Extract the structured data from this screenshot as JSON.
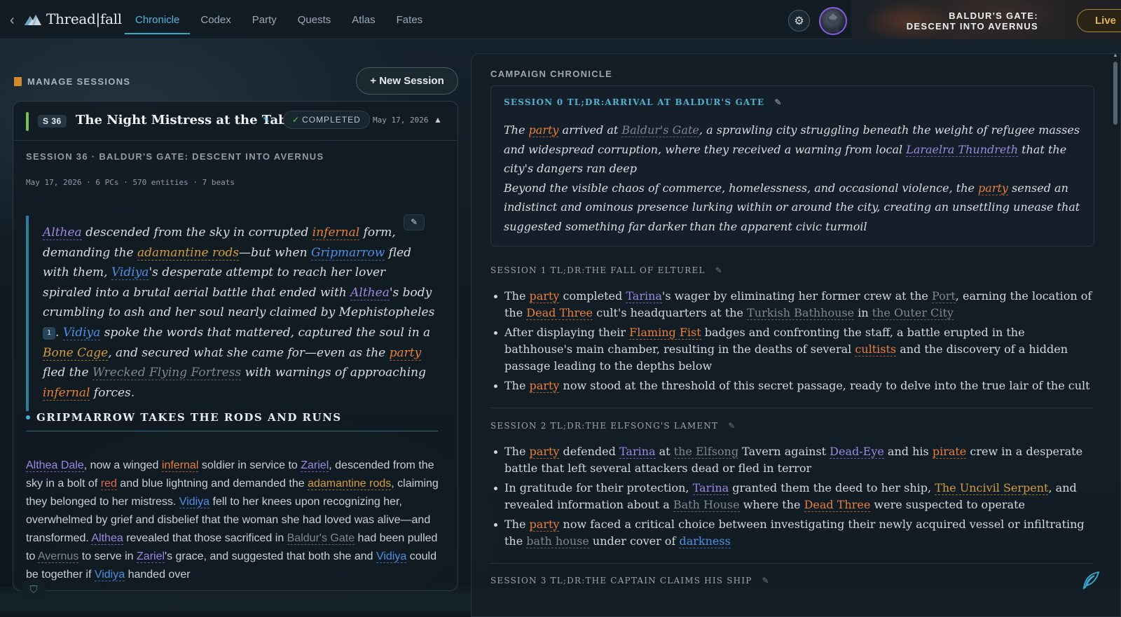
{
  "nav": {
    "back_glyph": "‹",
    "logo_text": "Thread|fall",
    "tabs": [
      {
        "label": "Chronicle",
        "active": true
      },
      {
        "label": "Codex"
      },
      {
        "label": "Party"
      },
      {
        "label": "Quests"
      },
      {
        "label": "Atlas"
      },
      {
        "label": "Fates"
      }
    ],
    "settings_icon": "gear-icon",
    "campaign_title_line1": "BALDUR'S GATE:",
    "campaign_title_line2": "DESCENT INTO AVERNUS",
    "live_label": "Live"
  },
  "sessions": {
    "manage_label": "MANAGE SESSIONS",
    "new_session_label": "+ New Session",
    "card": {
      "badge": "S 36",
      "title": "The Night Mistress at the Table",
      "status": "COMPLETED",
      "date": "May 17, 2026",
      "subtitle": "SESSION 36 · BALDUR'S GATE: DESCENT INTO AVERNUS",
      "meta": "May 17, 2026 · 6 PCs · 570 entities · 7 beats",
      "citation": "1",
      "beat_heading": "GRIPMARROW TAKES THE RODS AND RUNS",
      "summary_segments": [
        {
          "t": "Althea",
          "c": "e-purple"
        },
        {
          "t": " descended from the sky in corrupted "
        },
        {
          "t": "infernal",
          "c": "e-orange"
        },
        {
          "t": " form, demanding the "
        },
        {
          "t": "adamantine rods",
          "c": "e-gold"
        },
        {
          "t": "—but when "
        },
        {
          "t": "Gripmarrow",
          "c": "e-blue"
        },
        {
          "t": " fled with them, "
        },
        {
          "t": "Vidiya",
          "c": "e-blue"
        },
        {
          "t": "'s desperate attempt to reach her lover spiraled into a brutal aerial battle that ended with "
        },
        {
          "t": "Althea",
          "c": "e-purple"
        },
        {
          "t": "'s body crumbling to ash and her soul nearly claimed by Mephistopheles "
        },
        {
          "t": "1",
          "c": "cite"
        },
        {
          "t": ". "
        },
        {
          "t": "Vidiya",
          "c": "e-blue"
        },
        {
          "t": " spoke the words that mattered, captured the soul in a "
        },
        {
          "t": "Bone Cage",
          "c": "e-gold"
        },
        {
          "t": ", and secured what she came for—even as the "
        },
        {
          "t": "party",
          "c": "e-orange"
        },
        {
          "t": " fled the "
        },
        {
          "t": "Wrecked Flying Fortress",
          "c": "e-grey"
        },
        {
          "t": " with warnings of approaching "
        },
        {
          "t": "infernal",
          "c": "e-orange"
        },
        {
          "t": " forces."
        }
      ],
      "beat_segments": [
        {
          "t": "Althea Dale",
          "c": "e-purple"
        },
        {
          "t": ", now a winged "
        },
        {
          "t": "infernal",
          "c": "e-orange"
        },
        {
          "t": " soldier in service to "
        },
        {
          "t": "Zariel",
          "c": "e-purple"
        },
        {
          "t": ", descended from the sky in a bolt of "
        },
        {
          "t": "red",
          "c": "e-red"
        },
        {
          "t": " and blue lightning and demanded the "
        },
        {
          "t": "adamantine rods",
          "c": "e-gold"
        },
        {
          "t": ", claiming they belonged to her mistress. "
        },
        {
          "t": "Vidiya",
          "c": "e-blue"
        },
        {
          "t": " fell to her knees upon recognizing her, overwhelmed by grief and disbelief that the woman she had loved was alive—and transformed. "
        },
        {
          "t": "Althea",
          "c": "e-purple"
        },
        {
          "t": " revealed that those sacrificed in "
        },
        {
          "t": "Baldur's Gate",
          "c": "e-grey"
        },
        {
          "t": " had been pulled to "
        },
        {
          "t": "Avernus",
          "c": "e-grey"
        },
        {
          "t": " to serve in "
        },
        {
          "t": "Zariel",
          "c": "e-purple"
        },
        {
          "t": "'s grace, and suggested that both she and "
        },
        {
          "t": "Vidiya",
          "c": "e-blue"
        },
        {
          "t": " could be together if "
        },
        {
          "t": "Vidiya",
          "c": "e-blue"
        },
        {
          "t": " handed over"
        }
      ]
    }
  },
  "chronicle": {
    "label": "CAMPAIGN CHRONICLE",
    "sessions": [
      {
        "heading": "SESSION 0 TL;DR:ARRIVAL AT BALDUR'S GATE",
        "paragraphs": [
          [
            {
              "t": "The "
            },
            {
              "t": "party",
              "c": "e-orange"
            },
            {
              "t": " arrived at "
            },
            {
              "t": "Baldur's Gate",
              "c": "e-grey"
            },
            {
              "t": ", a sprawling city struggling beneath the weight of refugee masses and widespread corruption, where they received a warning from local "
            },
            {
              "t": "Laraelra Thundreth",
              "c": "e-purple"
            },
            {
              "t": " that the city's dangers ran deep"
            }
          ],
          [
            {
              "t": "Beyond the visible chaos of commerce, homelessness, and occasional violence, the "
            },
            {
              "t": "party",
              "c": "e-orange"
            },
            {
              "t": " sensed an indistinct and ominous presence lurking within or around the city, creating an unsettling unease that suggested something far darker than the apparent civic turmoil"
            }
          ]
        ]
      },
      {
        "heading": "SESSION 1 TL;DR:THE FALL OF ELTUREL",
        "bullets": [
          [
            {
              "t": "The "
            },
            {
              "t": "party",
              "c": "e-orange"
            },
            {
              "t": " completed "
            },
            {
              "t": "Tarina",
              "c": "e-purple"
            },
            {
              "t": "'s wager by eliminating her former crew at the "
            },
            {
              "t": "Port",
              "c": "e-grey"
            },
            {
              "t": ", earning the location of the "
            },
            {
              "t": "Dead Three",
              "c": "e-orange"
            },
            {
              "t": " cult's headquarters at the "
            },
            {
              "t": "Turkish Bathhouse",
              "c": "e-grey"
            },
            {
              "t": " in "
            },
            {
              "t": "the Outer City",
              "c": "e-grey"
            }
          ],
          [
            {
              "t": "After displaying their "
            },
            {
              "t": "Flaming Fist",
              "c": "e-orange"
            },
            {
              "t": " badges and confronting the staff, a battle erupted in the bathhouse's main chamber, resulting in the deaths of several "
            },
            {
              "t": "cultists",
              "c": "e-orange"
            },
            {
              "t": " and the discovery of a hidden passage leading to the depths below"
            }
          ],
          [
            {
              "t": "The "
            },
            {
              "t": "party",
              "c": "e-orange"
            },
            {
              "t": " now stood at the threshold of this secret passage, ready to delve into the true lair of the cult"
            }
          ]
        ]
      },
      {
        "heading": "SESSION 2 TL;DR:THE ELFSONG'S LAMENT",
        "bullets": [
          [
            {
              "t": "The "
            },
            {
              "t": "party",
              "c": "e-orange"
            },
            {
              "t": " defended "
            },
            {
              "t": "Tarina",
              "c": "e-purple"
            },
            {
              "t": " at "
            },
            {
              "t": "the Elfsong",
              "c": "e-grey"
            },
            {
              "t": " Tavern against "
            },
            {
              "t": "Dead-Eye",
              "c": "e-purple"
            },
            {
              "t": " and his "
            },
            {
              "t": "pirate",
              "c": "e-orange"
            },
            {
              "t": " crew in a desperate battle that left several attackers dead or fled in terror"
            }
          ],
          [
            {
              "t": "In gratitude for their protection, "
            },
            {
              "t": "Tarina",
              "c": "e-purple"
            },
            {
              "t": " granted them the deed to her ship, "
            },
            {
              "t": "The Uncivil Serpent",
              "c": "e-gold"
            },
            {
              "t": ", and revealed information about a "
            },
            {
              "t": "Bath House",
              "c": "e-grey"
            },
            {
              "t": " where the "
            },
            {
              "t": "Dead Three",
              "c": "e-orange"
            },
            {
              "t": " were suspected to operate"
            }
          ],
          [
            {
              "t": "The "
            },
            {
              "t": "party",
              "c": "e-orange"
            },
            {
              "t": " now faced a critical choice between investigating their newly acquired vessel or infiltrating the "
            },
            {
              "t": "bath house",
              "c": "e-grey"
            },
            {
              "t": " under cover of "
            },
            {
              "t": "darkness",
              "c": "e-blue"
            }
          ]
        ]
      },
      {
        "heading": "SESSION 3 TL;DR:THE CAPTAIN CLAIMS HIS SHIP"
      }
    ]
  },
  "colors": {
    "accent": "#3aa7cc",
    "completed": "#7ac05a",
    "live": "#e0b556",
    "avatar_ring": "#8a5ce0"
  }
}
